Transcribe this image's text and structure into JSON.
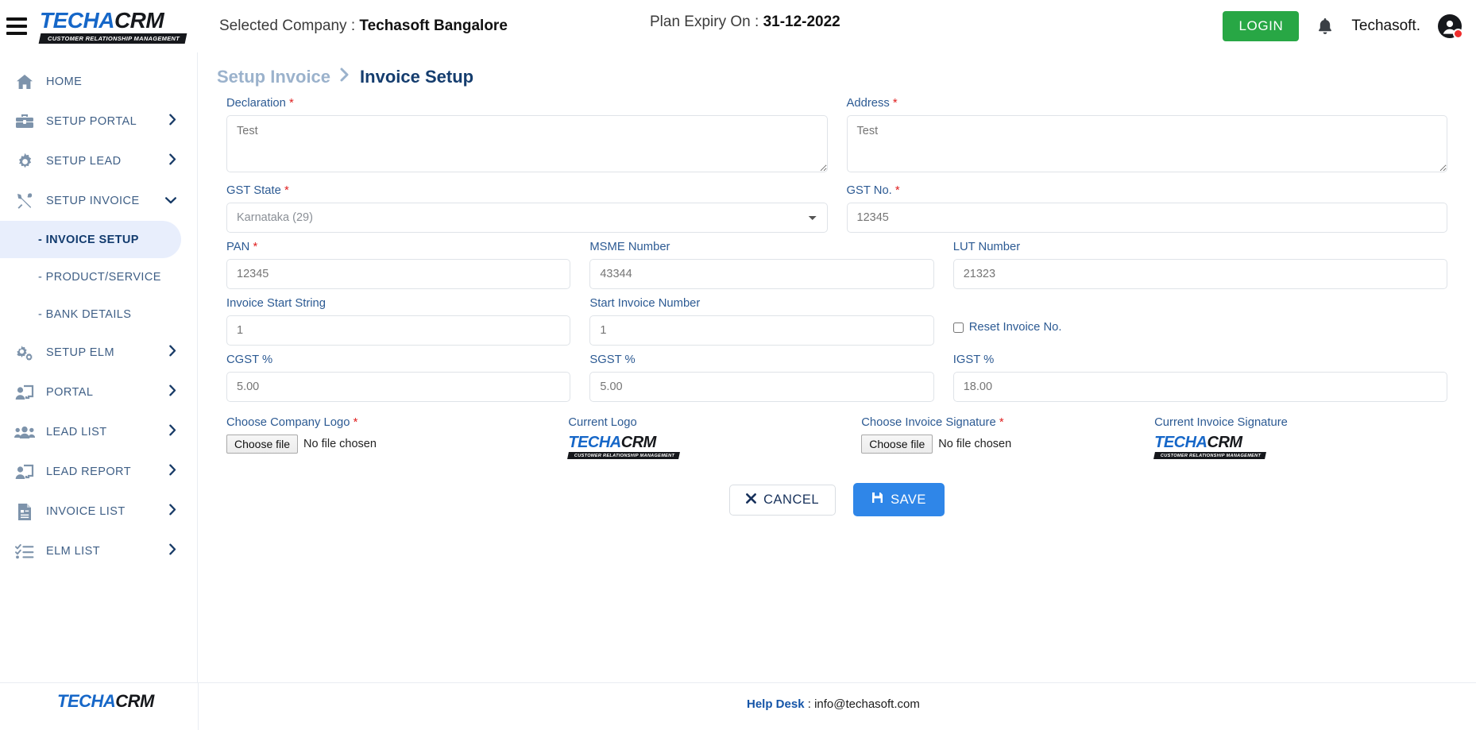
{
  "brand": {
    "logo_part1": "TECHA",
    "logo_part2": "CRM",
    "logo_tagline": "CUSTOMER RELATIONSHIP MANAGEMENT",
    "accent_blue": "#1667c8",
    "dark": "#16181c"
  },
  "topbar": {
    "menu_icon": "hamburger-icon",
    "selected_company_label": "Selected Company :",
    "selected_company_value": "Techasoft Bangalore",
    "plan_expiry_label": "Plan Expiry On :",
    "plan_expiry_value": "31-12-2022",
    "login_label": "LOGIN",
    "login_color": "#28a745",
    "notification_icon": "bell-icon",
    "user_name": "Techasoft.",
    "avatar_icon": "user-avatar-icon",
    "badge_color": "#ef2d2d"
  },
  "sidebar": {
    "items": [
      {
        "label": "HOME",
        "icon": "home-icon",
        "has_chevron": false
      },
      {
        "label": "SETUP PORTAL",
        "icon": "toolbox-icon",
        "has_chevron": true
      },
      {
        "label": "SETUP LEAD",
        "icon": "gear-icon",
        "has_chevron": true
      },
      {
        "label": "SETUP INVOICE",
        "icon": "tools-icon",
        "has_chevron": true,
        "expanded": true
      },
      {
        "label": "SETUP ELM",
        "icon": "gears-icon",
        "has_chevron": true
      },
      {
        "label": "PORTAL",
        "icon": "portal-user-icon",
        "has_chevron": true
      },
      {
        "label": "LEAD LIST",
        "icon": "users-icon",
        "has_chevron": true
      },
      {
        "label": "LEAD REPORT",
        "icon": "portal-user-icon",
        "has_chevron": true
      },
      {
        "label": "INVOICE LIST",
        "icon": "document-icon",
        "has_chevron": true
      },
      {
        "label": "ELM LIST",
        "icon": "checklist-icon",
        "has_chevron": true
      }
    ],
    "sub_items": [
      {
        "label": "- INVOICE SETUP",
        "active": true
      },
      {
        "label": "- PRODUCT/SERVICE",
        "active": false
      },
      {
        "label": "- BANK DETAILS",
        "active": false
      }
    ],
    "active_bg": "#e8eefc"
  },
  "breadcrumb": {
    "parent": "Setup Invoice",
    "separator": "chevron-right-icon",
    "current": "Invoice Setup"
  },
  "form": {
    "declaration": {
      "label": "Declaration",
      "required": true,
      "value": "Test",
      "placeholder": "Test"
    },
    "address": {
      "label": "Address",
      "required": true,
      "value": "Test",
      "placeholder": "Test"
    },
    "gst_state": {
      "label": "GST State",
      "required": true,
      "value": "Karnataka (29)",
      "options": [
        "Karnataka (29)"
      ]
    },
    "gst_no": {
      "label": "GST No.",
      "required": true,
      "value": "12345",
      "placeholder": "12345"
    },
    "pan": {
      "label": "PAN",
      "required": true,
      "value": "12345",
      "placeholder": "12345"
    },
    "msme_number": {
      "label": "MSME Number",
      "required": false,
      "value": "43344",
      "placeholder": "43344"
    },
    "lut_number": {
      "label": "LUT Number",
      "required": false,
      "value": "21323",
      "placeholder": "21323"
    },
    "invoice_start_string": {
      "label": "Invoice Start String",
      "required": false,
      "value": "1",
      "placeholder": "1"
    },
    "start_invoice_number": {
      "label": "Start Invoice Number",
      "required": false,
      "value": "1",
      "placeholder": "1"
    },
    "reset_invoice_no": {
      "label": "Reset Invoice No.",
      "checked": false
    },
    "cgst": {
      "label": "CGST %",
      "required": false,
      "value": "5.00",
      "placeholder": "5.00"
    },
    "sgst": {
      "label": "SGST %",
      "required": false,
      "value": "5.00",
      "placeholder": "5.00"
    },
    "igst": {
      "label": "IGST %",
      "required": false,
      "value": "18.00",
      "placeholder": "18.00"
    },
    "company_logo": {
      "label": "Choose Company Logo",
      "required": true,
      "button_label": "Choose file",
      "status": "No file chosen"
    },
    "current_logo": {
      "label": "Current Logo"
    },
    "invoice_signature": {
      "label": "Choose Invoice Signature",
      "required": true,
      "button_label": "Choose file",
      "status": "No file chosen"
    },
    "current_signature": {
      "label": "Current Invoice Signature"
    },
    "required_marker": "*"
  },
  "actions": {
    "cancel_label": "CANCEL",
    "cancel_icon": "close-x-icon",
    "save_label": "SAVE",
    "save_icon": "floppy-save-icon",
    "save_color": "#2f86e8"
  },
  "footer": {
    "help_label": "Help Desk",
    "help_separator": " : ",
    "help_email": "info@techasoft.com"
  }
}
